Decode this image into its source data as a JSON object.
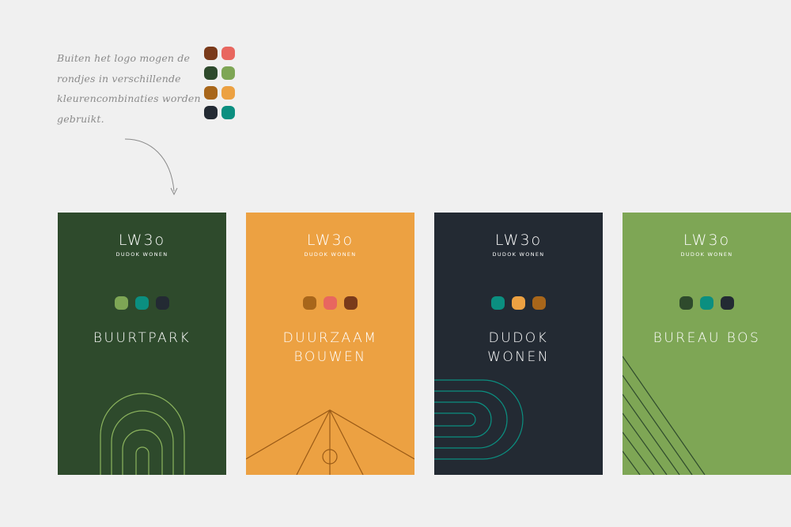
{
  "note": {
    "lines": [
      "Buiten het logo mogen de",
      "rondjes in verschillende",
      "kleurencombinaties worden",
      "gebruikt."
    ]
  },
  "swatches": [
    [
      "#7a3a1a",
      "#e8675f"
    ],
    [
      "#2e4a2c",
      "#7ea655"
    ],
    [
      "#a8661a",
      "#eca142"
    ],
    [
      "#232a33",
      "#0b8f80"
    ]
  ],
  "cards": [
    {
      "bg": "#2e4a2c",
      "logo": "LW3o",
      "logo_sub": "DUDOK WONEN",
      "dots": [
        "#7ea655",
        "#0b8f80",
        "#232a33"
      ],
      "title_lines": [
        "BUURTPARK"
      ],
      "line_color": "#8cb45e"
    },
    {
      "bg": "#eca142",
      "logo": "LW3o",
      "logo_sub": "DUDOK WONEN",
      "dots": [
        "#a8661a",
        "#e8675f",
        "#7a3a1a"
      ],
      "title_lines": [
        "DUURZAAM",
        "BOUWEN"
      ],
      "line_color": "#9a5a16"
    },
    {
      "bg": "#232a33",
      "logo": "LW3o",
      "logo_sub": "DUDOK WONEN",
      "dots": [
        "#0b8f80",
        "#eca142",
        "#a8661a"
      ],
      "title_lines": [
        "DUDOK",
        "WONEN"
      ],
      "line_color": "#0b8f80"
    },
    {
      "bg": "#7ea655",
      "logo": "LW3o",
      "logo_sub": "DUDOK WONEN",
      "dots": [
        "#2e4a2c",
        "#0b8f80",
        "#232a33"
      ],
      "title_lines": [
        "BUREAU BOS"
      ],
      "line_color": "#2e4a2c"
    }
  ]
}
